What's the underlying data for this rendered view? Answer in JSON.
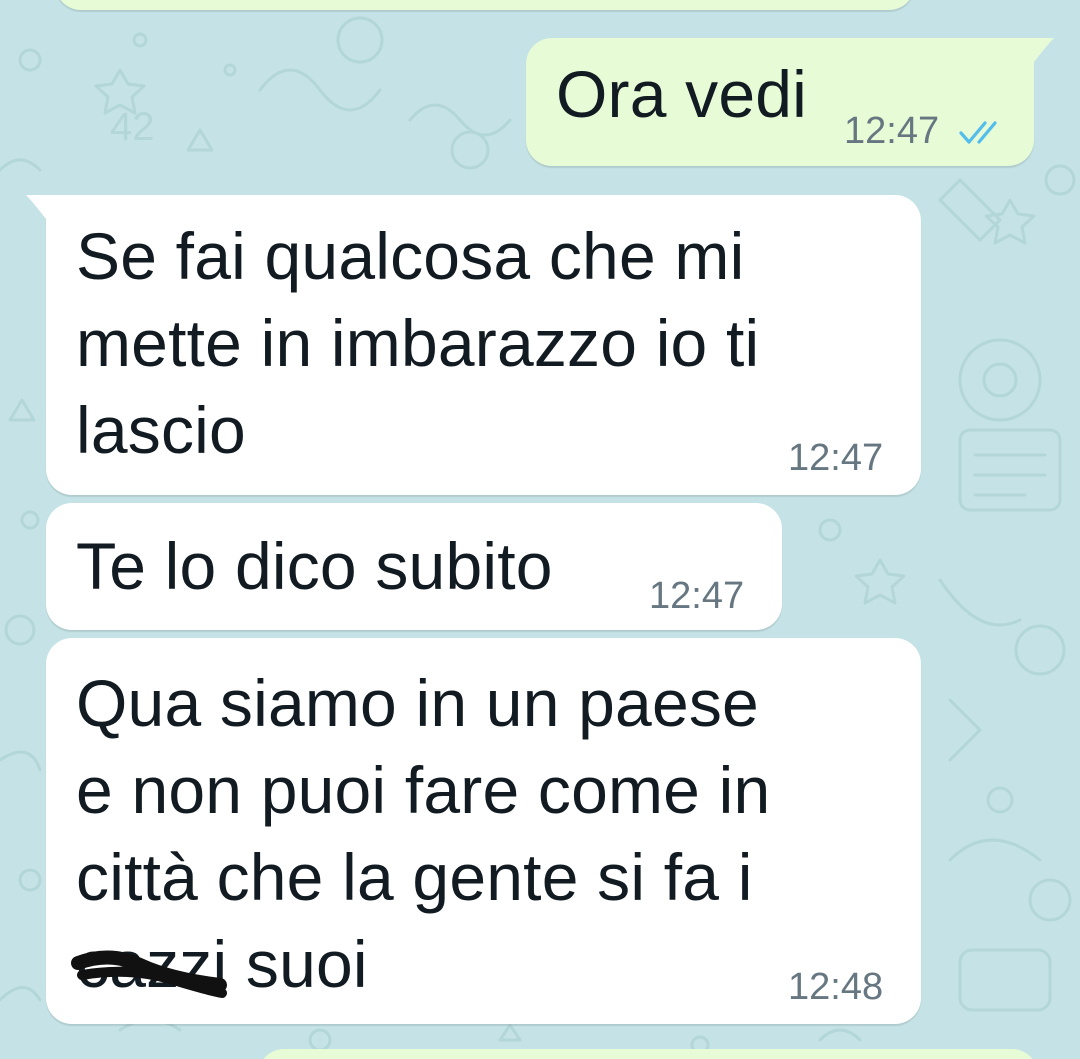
{
  "chat": {
    "messages": [
      {
        "direction": "outgoing",
        "text": "Ora vedi",
        "time": "12:47",
        "status": "read-double-check-icon"
      },
      {
        "direction": "incoming",
        "text": "Se fai qualcosa che mi\nmette in imbarazzo io ti\nlascio",
        "time": "12:47"
      },
      {
        "direction": "incoming",
        "text": "Te lo dico subito",
        "time": "12:47"
      },
      {
        "direction": "incoming",
        "text": "Qua siamo in un paese\ne non puoi fare come in\ncittà che la gente si fa i\ncazzi suoi",
        "time": "12:48"
      }
    ]
  },
  "colors": {
    "wallpaper": "#c5e3e6",
    "incoming_bubble": "#ffffff",
    "outgoing_bubble": "#e7fbd7",
    "timestamp": "#667781",
    "read_ticks": "#53bdeb"
  }
}
